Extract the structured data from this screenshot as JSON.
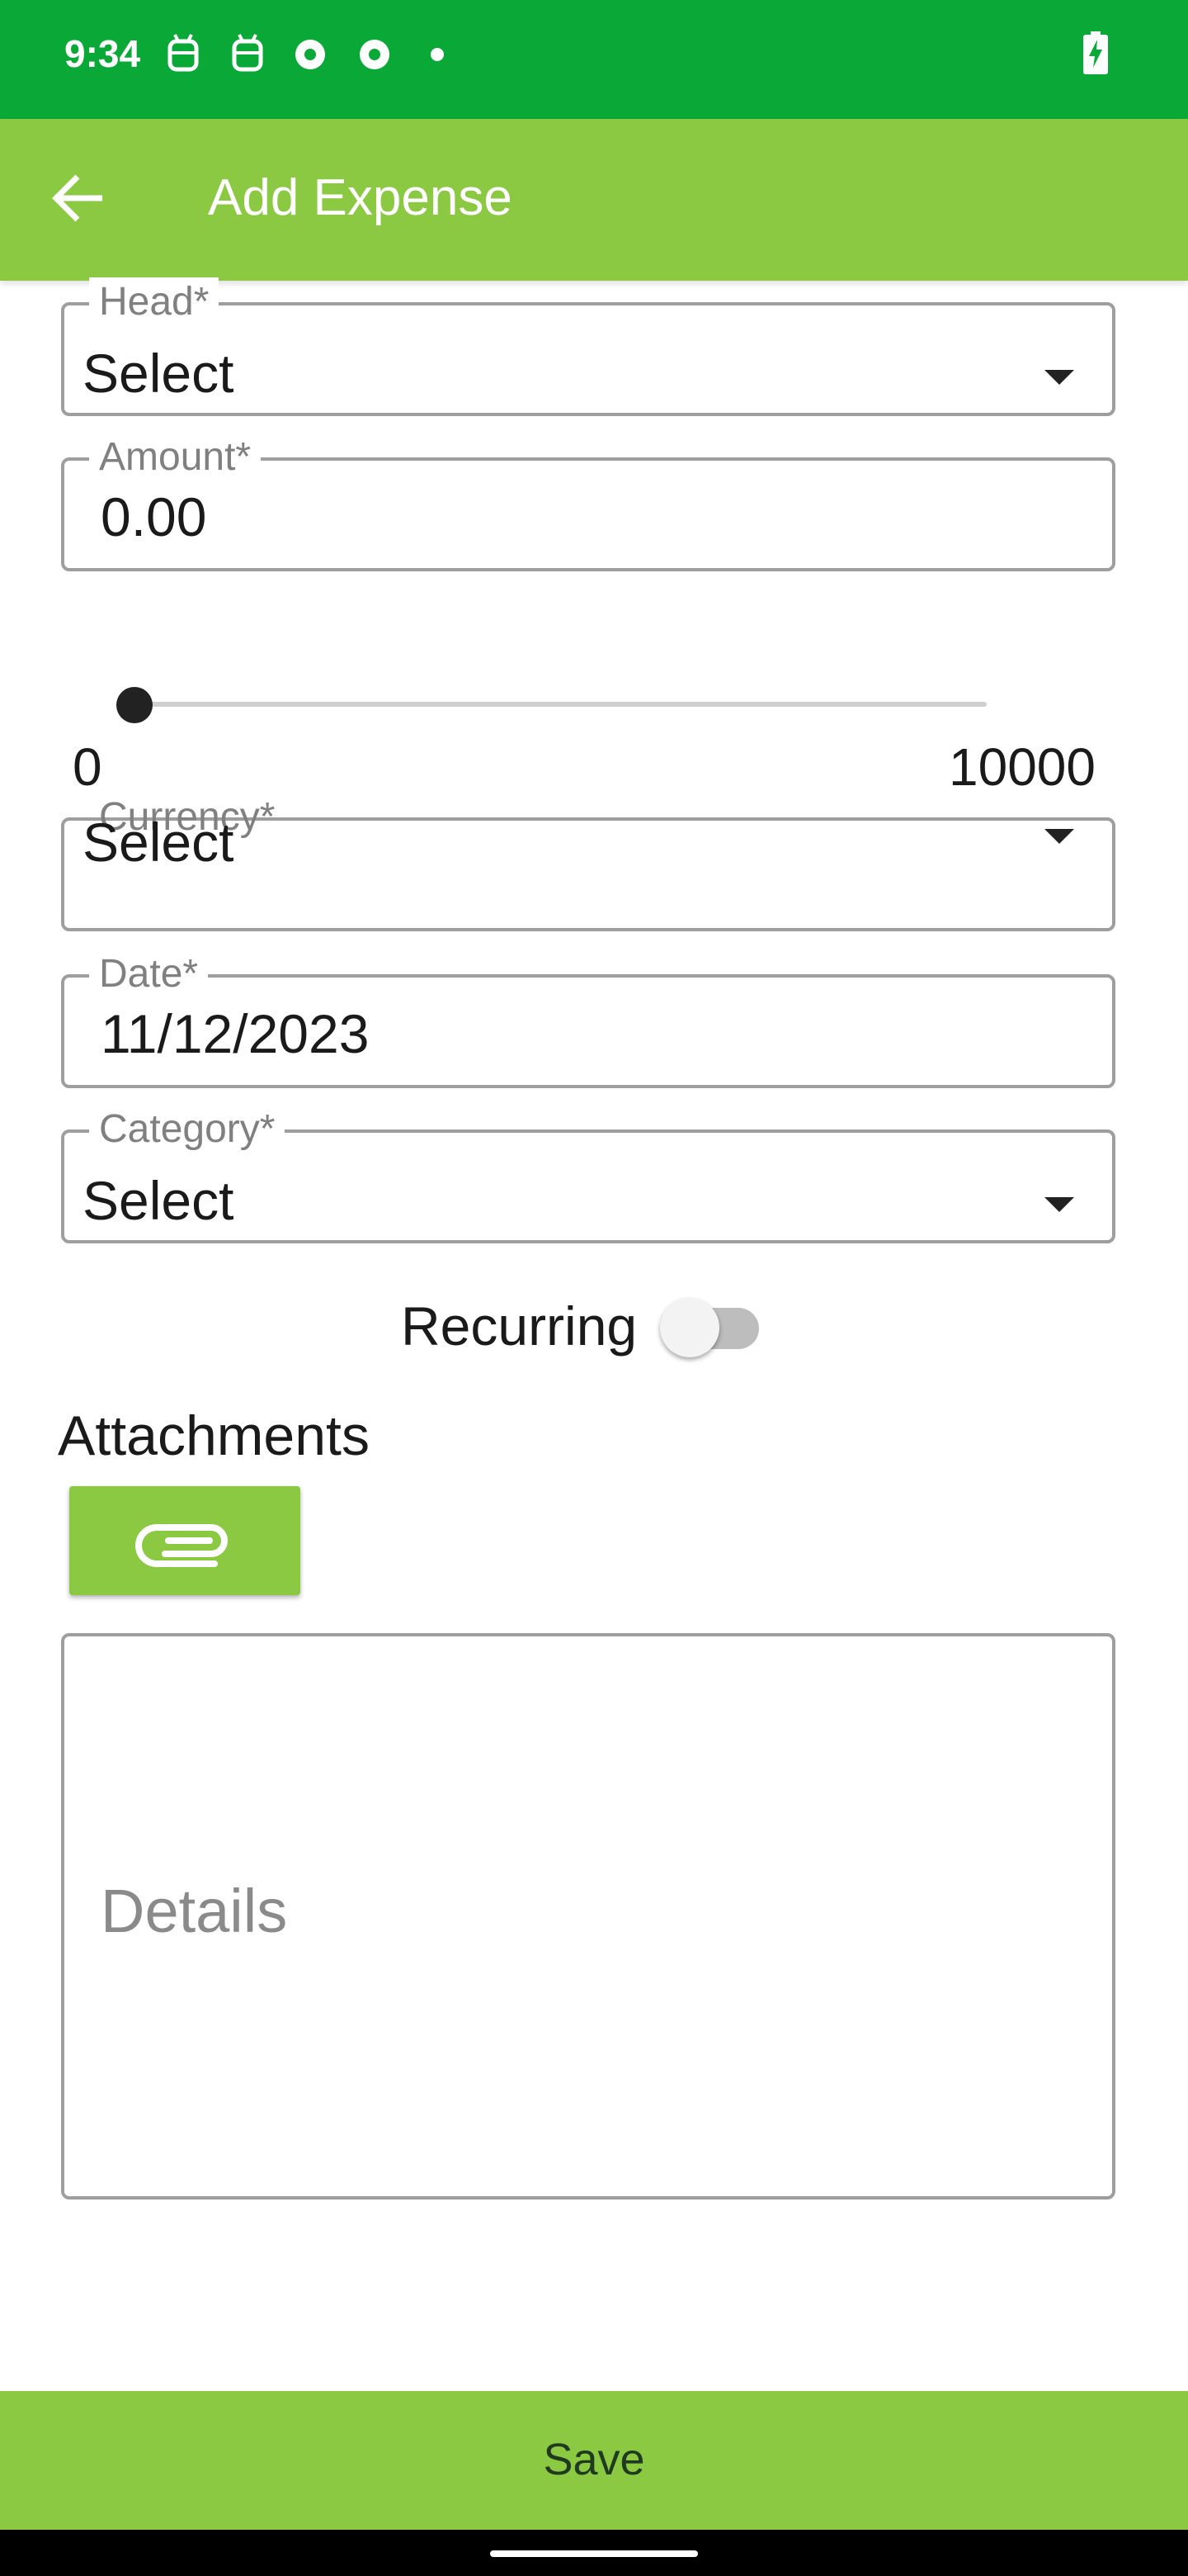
{
  "status_bar": {
    "time": "9:34",
    "icons": [
      "android-icon",
      "android-icon",
      "chrome-icon",
      "chrome-icon",
      "dot-icon",
      "battery-charging-icon"
    ]
  },
  "app_bar": {
    "title": "Add Expense",
    "back_icon": "arrow-left-icon"
  },
  "form": {
    "head": {
      "label": "Head*",
      "value": "Select"
    },
    "amount": {
      "label": "Amount*",
      "value": "0.00"
    },
    "slider": {
      "min_label": "0",
      "max_label": "10000",
      "value": 0
    },
    "currency": {
      "label": "Currency*",
      "value": "Select"
    },
    "date": {
      "label": "Date*",
      "value": "11/12/2023"
    },
    "category": {
      "label": "Category*",
      "value": "Select"
    },
    "recurring": {
      "label": "Recurring",
      "on": false
    },
    "attachments": {
      "label": "Attachments",
      "icon": "paperclip-icon"
    },
    "details": {
      "placeholder": "Details"
    }
  },
  "footer": {
    "save_label": "Save"
  },
  "colors": {
    "status_bar": "#0aa937",
    "accent": "#8bc943"
  }
}
